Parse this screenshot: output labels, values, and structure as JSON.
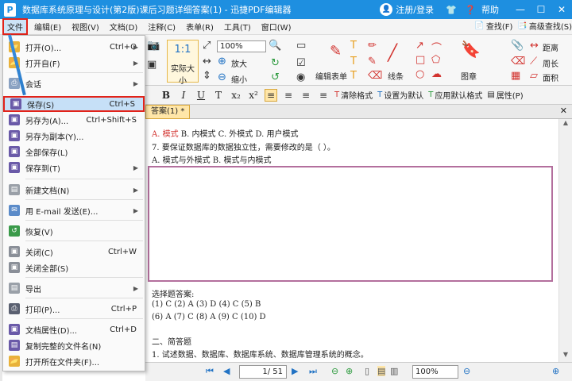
{
  "titlebar": {
    "app_icon": "P",
    "title": "数据库系统原理与设计(第2版)课后习题详细答案(1) - 迅捷PDF编辑器",
    "login": "注册/登录",
    "help": "帮助",
    "icons": [
      "minimize-icon",
      "maximize-icon",
      "close-icon"
    ]
  },
  "menubar": [
    "文件",
    "编辑(E)",
    "视图(V)",
    "文档(D)",
    "注释(C)",
    "表单(R)",
    "工具(T)",
    "窗口(W)"
  ],
  "ribbon": {
    "find": "查找(F)",
    "adv_find": "高级查找(S)",
    "zoom": "100%",
    "actual_size": "实际大小",
    "zoom_in": "放大",
    "zoom_out": "缩小",
    "edit_form": "编辑表单",
    "line": "线条",
    "stamp": "图章",
    "distance": "距离",
    "perimeter": "周长",
    "area": "面积"
  },
  "formatbar": {
    "clear": "清除格式",
    "set_default": "设置为默认",
    "apply_default": "应用默认格式",
    "props": "属性(P)"
  },
  "tab": {
    "label": "答案(1) *"
  },
  "doc": {
    "line1_prefix": "A.  ",
    "line1_red": "模式",
    "line1_rest": "  B. 内模式  C. 外模式  D. 用户模式",
    "line2": "7. 要保证数据库的数据独立性，需要修改的是（  ）。",
    "line3": "A. 模式与外模式  B. 模式与内模式",
    "line4": "选择题答案:",
    "line5": "(1) C (2) A (3) D (4) C (5) B",
    "line6": "(6) A (7) C (8) A (9) C (10) D",
    "line7": "二、简答题",
    "line8": "1. 试述数据、数据库、数据库系统、数据库管理系统的概念。"
  },
  "statusbar": {
    "page": "1",
    "total": "/ 51",
    "zoom": "100%"
  },
  "filemenu": [
    {
      "label": "打开(O)...",
      "shortcut": "Ctrl+O",
      "arrow": true,
      "color": "#e8b23a"
    },
    {
      "label": "打开自(F)",
      "shortcut": "",
      "arrow": true,
      "color": "#e8b23a"
    },
    {
      "label": "会话",
      "shortcut": "",
      "arrow": true,
      "color": "#8aa2c2"
    },
    {
      "label": "保存(S)",
      "shortcut": "Ctrl+S",
      "arrow": false,
      "color": "#6a5aa8"
    },
    {
      "label": "另存为(A)...",
      "shortcut": "Ctrl+Shift+S",
      "arrow": false,
      "color": "#6a5aa8"
    },
    {
      "label": "另存为副本(Y)...",
      "shortcut": "",
      "arrow": false,
      "color": "#6a5aa8"
    },
    {
      "label": "全部保存(L)",
      "shortcut": "",
      "arrow": false,
      "color": "#6a5aa8"
    },
    {
      "label": "保存到(T)",
      "shortcut": "",
      "arrow": true,
      "color": "#6a5aa8"
    },
    {
      "label": "新建文档(N)",
      "shortcut": "",
      "arrow": true,
      "color": "#9aa0a8"
    },
    {
      "label": "用 E-mail 发送(E)...",
      "shortcut": "",
      "arrow": true,
      "color": "#5b8bc9"
    },
    {
      "label": "恢复(V)",
      "shortcut": "",
      "arrow": false,
      "color": "#3a9a4a"
    },
    {
      "label": "关闭(C)",
      "shortcut": "Ctrl+W",
      "arrow": false,
      "color": "#8a8f98"
    },
    {
      "label": "关闭全部(S)",
      "shortcut": "",
      "arrow": false,
      "color": "#8a8f98"
    },
    {
      "label": "导出",
      "shortcut": "",
      "arrow": true,
      "color": "#9aa0a8"
    },
    {
      "label": "打印(P)...",
      "shortcut": "Ctrl+P",
      "arrow": false,
      "color": "#5a6070"
    },
    {
      "label": "文档属性(D)...",
      "shortcut": "Ctrl+D",
      "arrow": false,
      "color": "#6a5aa8"
    },
    {
      "label": "复制完整的文件名(N)",
      "shortcut": "",
      "arrow": false,
      "color": "#6a5aa8"
    },
    {
      "label": "打开所在文件夹(F)...",
      "shortcut": "",
      "arrow": false,
      "color": "#e8b23a"
    }
  ]
}
